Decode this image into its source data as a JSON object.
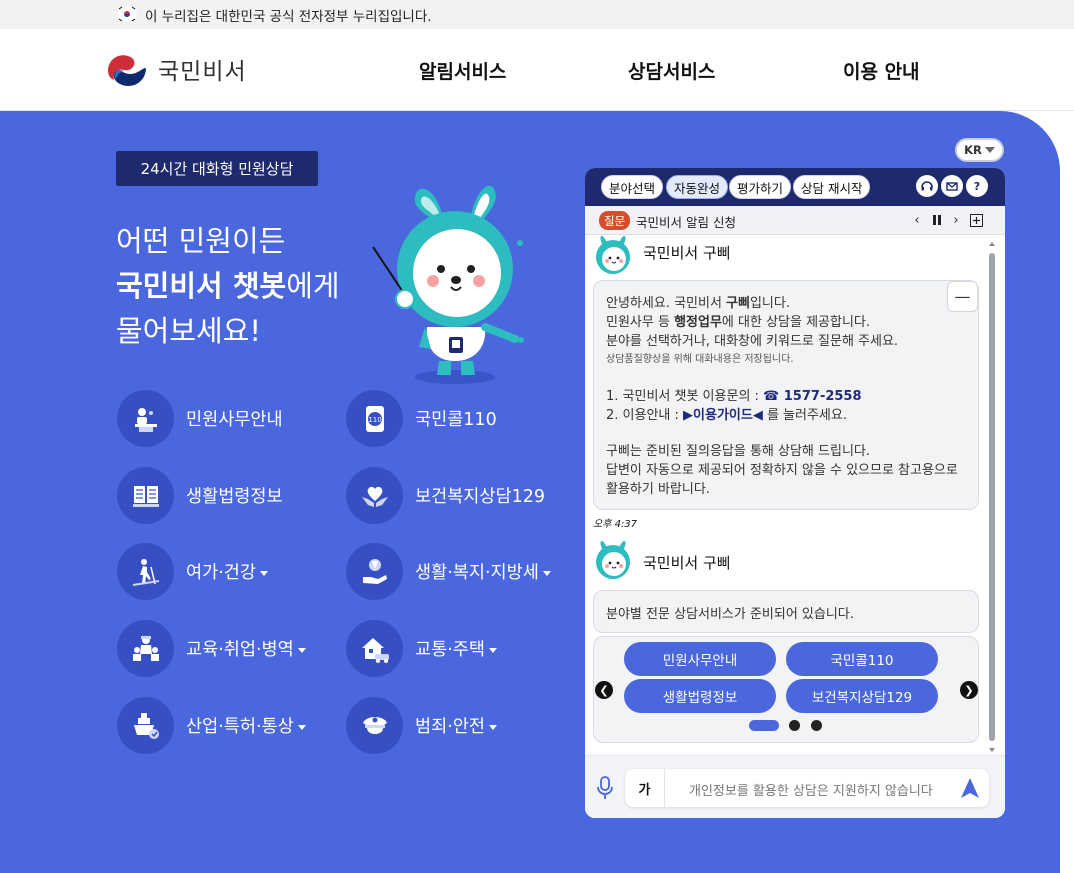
{
  "gov_bar": {
    "text": "이 누리집은 대한민국 공식 전자정부 누리집입니다."
  },
  "header": {
    "logo_text": "국민비서",
    "nav": [
      "알림서비스",
      "상담서비스",
      "이용 안내"
    ]
  },
  "hero": {
    "badge": "24시간 대화형 민원상담",
    "line1": "어떤 민원이든",
    "line2_bold": "국민비서 챗봇",
    "line2_rest": "에게",
    "line3": "물어보세요!"
  },
  "services": [
    {
      "label": "민원사무안내",
      "icon": "civil-desk-icon",
      "dropdown": false
    },
    {
      "label": "국민콜110",
      "icon": "phone-110-icon",
      "dropdown": false
    },
    {
      "label": "생활법령정보",
      "icon": "law-book-icon",
      "dropdown": false
    },
    {
      "label": "보건복지상담129",
      "icon": "heart-hands-icon",
      "dropdown": false
    },
    {
      "label": "여가·건강",
      "icon": "hiking-icon",
      "dropdown": true
    },
    {
      "label": "생활·복지·지방세",
      "icon": "welfare-hand-icon",
      "dropdown": true
    },
    {
      "label": "교육·취업·병역",
      "icon": "people-group-icon",
      "dropdown": true
    },
    {
      "label": "교통·주택",
      "icon": "house-car-icon",
      "dropdown": true
    },
    {
      "label": "산업·특허·통상",
      "icon": "factory-ship-icon",
      "dropdown": true
    },
    {
      "label": "범죄·안전",
      "icon": "police-cap-icon",
      "dropdown": true
    }
  ],
  "lang": "KR",
  "chat": {
    "top_buttons": [
      "분야선택",
      "자동완성",
      "평가하기",
      "상담 재시작"
    ],
    "active_button": "자동완성",
    "top_icons": [
      "headset-icon",
      "mail-icon",
      "help-icon"
    ],
    "question_badge": "질문",
    "question_text": "국민비서 알림 신청",
    "bot_name": "국민비서 구삐",
    "msg1": {
      "l1a": "안녕하세요. 국민비서 ",
      "l1b": "구삐",
      "l1c": "입니다.",
      "l2a": "민원사무 등 ",
      "l2b": "행정업무",
      "l2c": "에 대한 상담을 제공합니다.",
      "l3": "분야를 선택하거나, 대화창에 키워드로 질문해 주세요.",
      "l4": "상담품질향상을 위해 대화내용은 저장됩니다.",
      "l5a": "1. 국민비서 챗봇 이용문의 : ",
      "l5b": "☎ 1577-2558",
      "l6a": "2. 이용안내 : ",
      "l6b": "▶이용가이드◀",
      "l6c": " 를 눌러주세요.",
      "l7": "구삐는 준비된 질의응답을 통해 상담해 드립니다.",
      "l8": "답변이 자동으로 제공되어 정확하지 않을 수 있으므로 참고용으로",
      "l9": "활용하기 바랍니다."
    },
    "minimize": "—",
    "time": "오후 4:37",
    "msg2": "분야별 전문 상담서비스가 준비되어 있습니다.",
    "quick_buttons": [
      "민원사무안내",
      "국민콜110",
      "생활법령정보",
      "보건복지상담129"
    ],
    "carousel_pages": 3,
    "carousel_active": 1,
    "input_mode": "가",
    "input_placeholder": "개인정보를 활용한 상담은 지원하지 않습니다"
  },
  "colors": {
    "brand_blue": "#4a67dd",
    "navy": "#1f2a6e",
    "question_red": "#d64d2e"
  }
}
